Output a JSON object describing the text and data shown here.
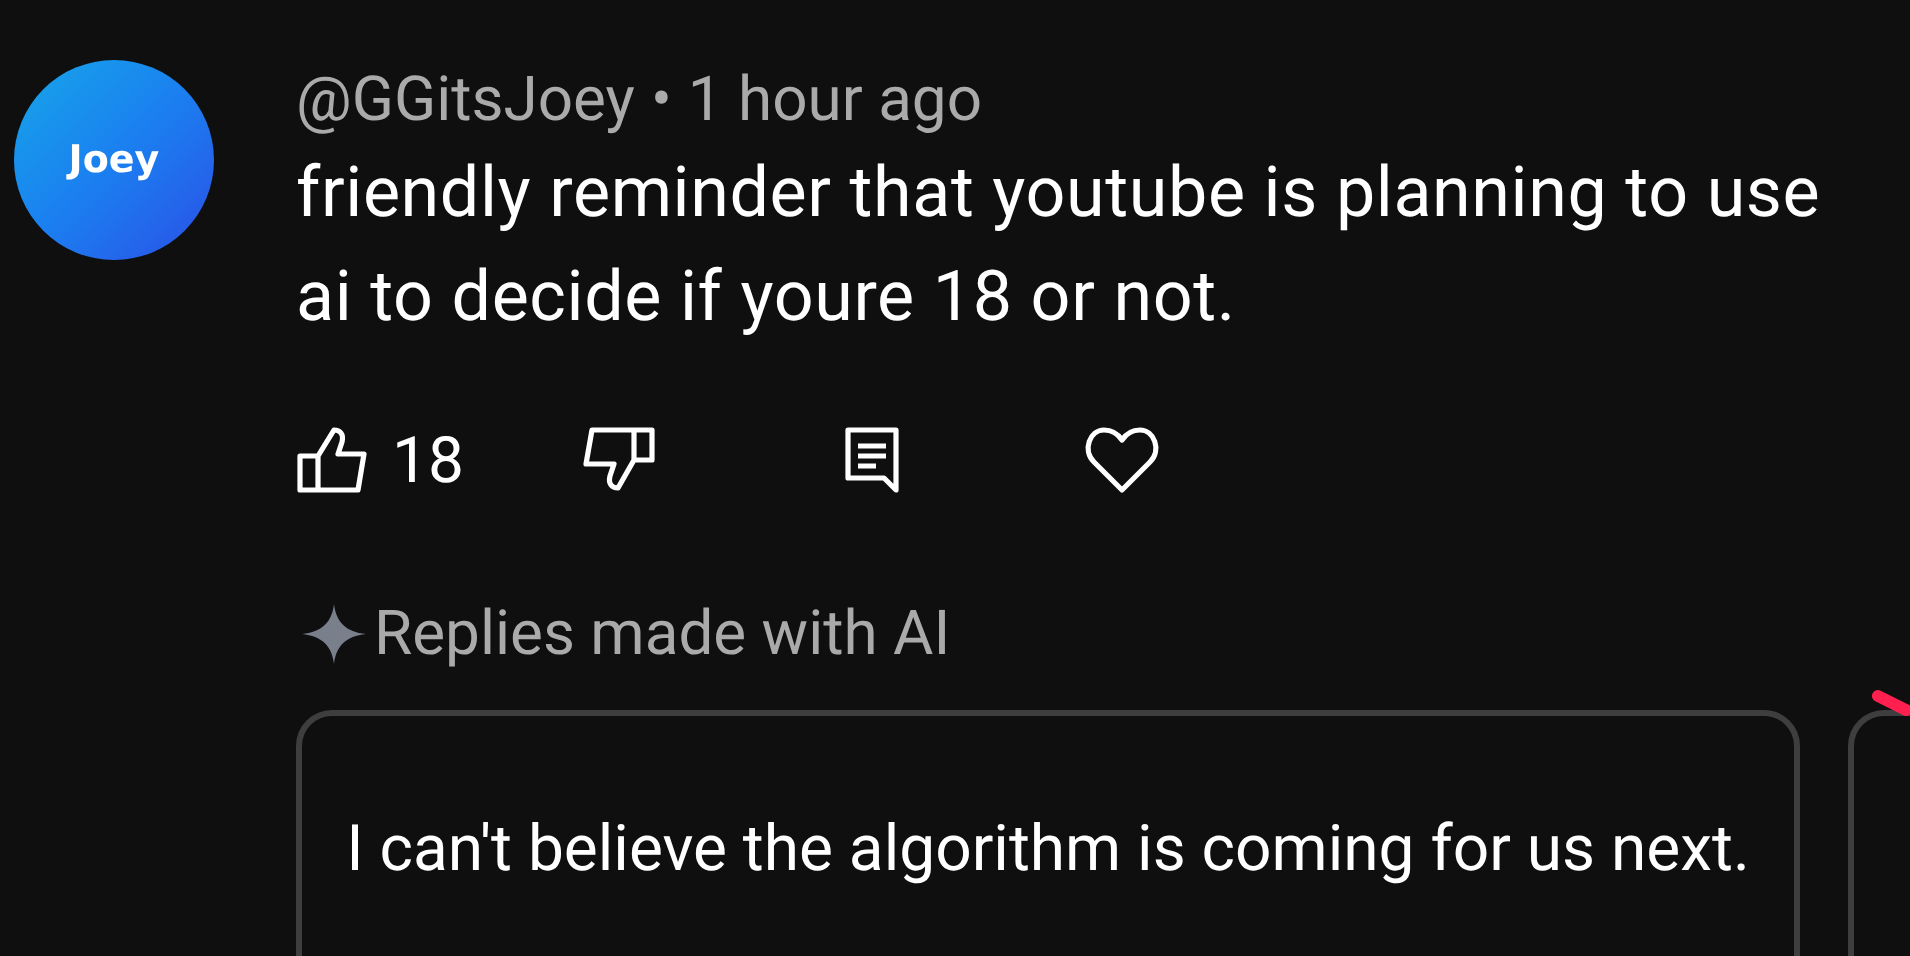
{
  "comment": {
    "avatar_text": "Joey",
    "author": "@GGitsJoey",
    "separator": "•",
    "time": "1 hour ago",
    "text": "friendly reminder that youtube is planning to use ai to decide if youre 18 or not.",
    "like_count": "18"
  },
  "ai_replies": {
    "label": "Replies made with AI",
    "suggestions": [
      {
        "text": "I can't believe the algorithm is coming for us next."
      }
    ],
    "more_cards": true
  }
}
